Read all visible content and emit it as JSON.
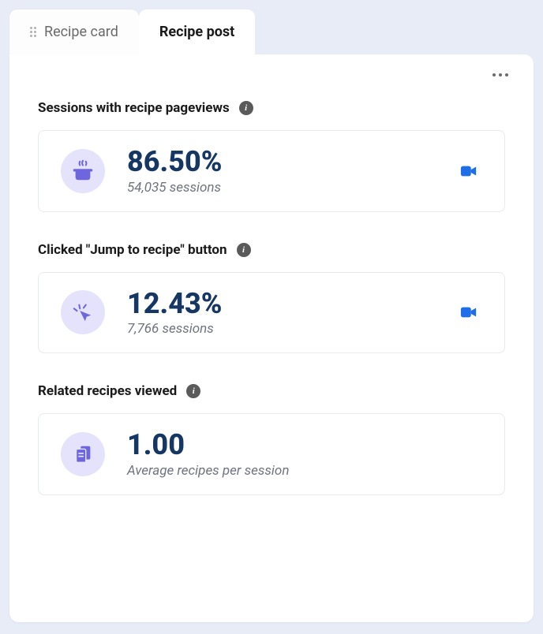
{
  "tabs": [
    {
      "label": "Recipe card",
      "active": false
    },
    {
      "label": "Recipe post",
      "active": true
    }
  ],
  "sections": {
    "pageviews": {
      "title": "Sessions with recipe pageviews",
      "value": "86.50%",
      "sub": "54,035 sessions"
    },
    "jump": {
      "title": "Clicked \"Jump to recipe\" button",
      "value": "12.43%",
      "sub": "7,766 sessions"
    },
    "related": {
      "title": "Related recipes viewed",
      "value": "1.00",
      "sub": "Average recipes per session"
    }
  }
}
